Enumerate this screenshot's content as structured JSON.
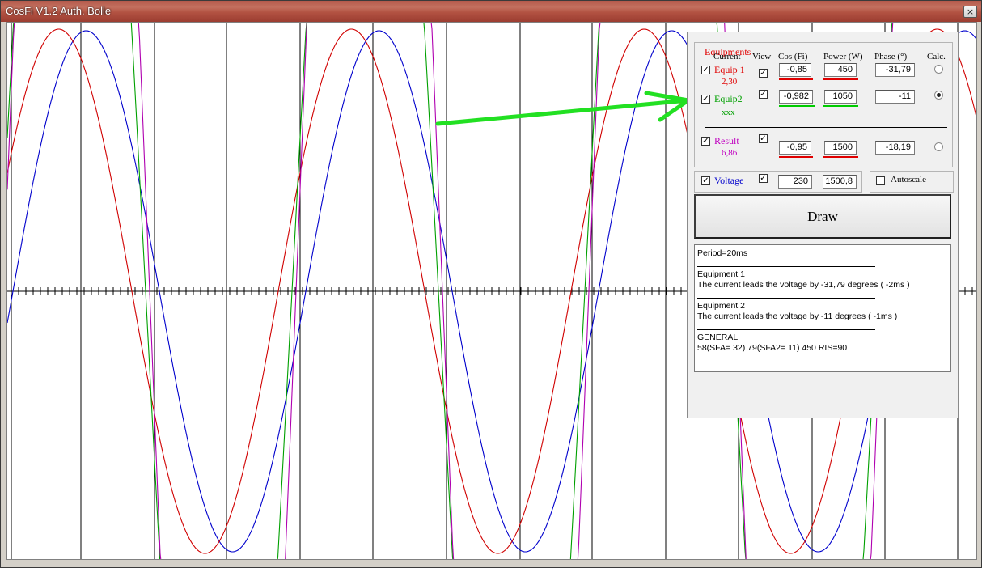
{
  "window": {
    "title": "CosFi V1.2 Auth. Bolle",
    "close_glyph": "×"
  },
  "plot": {
    "colors": {
      "voltage": "#0000cc",
      "equip1": "#d00000",
      "equip2": "#00a000",
      "result": "#b000b0",
      "arrow": "#22e022"
    }
  },
  "panel": {
    "group_title": "Equipments",
    "headers": {
      "current": "Current",
      "view": "View",
      "cosfi": "Cos (Fi)",
      "power": "Power (W)",
      "phase": "Phase (°)",
      "calc": "Calc."
    },
    "check_glyph": "✓",
    "equip1": {
      "name": "Equip 1",
      "current": "2,30",
      "cosfi": "-0,85",
      "power": "450",
      "phase": "-31,79",
      "color": "#e00000"
    },
    "equip2": {
      "name": "Equip2",
      "current": "xxx",
      "cosfi": "-0,982",
      "power": "1050",
      "phase": "-11",
      "color": "#00a000"
    },
    "result": {
      "name": "Result",
      "current": "6,86",
      "cosfi": "-0,95",
      "power": "1500",
      "phase": "-18,19",
      "color": "#c000c0"
    },
    "voltage": {
      "name": "Voltage",
      "value": "230",
      "power": "1500,8",
      "color": "#0000cc"
    },
    "autoscale_label": "Autoscale",
    "draw_label": "Draw",
    "info": {
      "period": "Period=20ms",
      "eq1_title": "Equipment 1",
      "eq1_text": "The current leads the voltage by -31,79 degrees ( -2ms )",
      "eq2_title": "Equipment 2",
      "eq2_text": "The current leads the voltage by -11 degrees ( -1ms )",
      "general_title": "GENERAL",
      "general_text": "58(SFA= 32) 79(SFA2= 11)   450 RIS=90"
    }
  }
}
